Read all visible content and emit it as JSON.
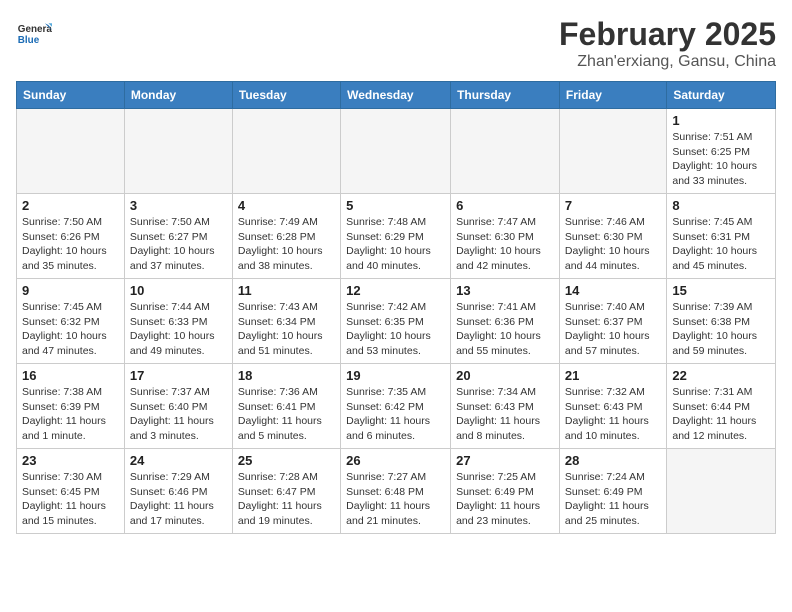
{
  "header": {
    "logo_general": "General",
    "logo_blue": "Blue",
    "month_year": "February 2025",
    "location": "Zhan'erxiang, Gansu, China"
  },
  "days_of_week": [
    "Sunday",
    "Monday",
    "Tuesday",
    "Wednesday",
    "Thursday",
    "Friday",
    "Saturday"
  ],
  "weeks": [
    [
      {
        "day": "",
        "info": ""
      },
      {
        "day": "",
        "info": ""
      },
      {
        "day": "",
        "info": ""
      },
      {
        "day": "",
        "info": ""
      },
      {
        "day": "",
        "info": ""
      },
      {
        "day": "",
        "info": ""
      },
      {
        "day": "1",
        "info": "Sunrise: 7:51 AM\nSunset: 6:25 PM\nDaylight: 10 hours and 33 minutes."
      }
    ],
    [
      {
        "day": "2",
        "info": "Sunrise: 7:50 AM\nSunset: 6:26 PM\nDaylight: 10 hours and 35 minutes."
      },
      {
        "day": "3",
        "info": "Sunrise: 7:50 AM\nSunset: 6:27 PM\nDaylight: 10 hours and 37 minutes."
      },
      {
        "day": "4",
        "info": "Sunrise: 7:49 AM\nSunset: 6:28 PM\nDaylight: 10 hours and 38 minutes."
      },
      {
        "day": "5",
        "info": "Sunrise: 7:48 AM\nSunset: 6:29 PM\nDaylight: 10 hours and 40 minutes."
      },
      {
        "day": "6",
        "info": "Sunrise: 7:47 AM\nSunset: 6:30 PM\nDaylight: 10 hours and 42 minutes."
      },
      {
        "day": "7",
        "info": "Sunrise: 7:46 AM\nSunset: 6:30 PM\nDaylight: 10 hours and 44 minutes."
      },
      {
        "day": "8",
        "info": "Sunrise: 7:45 AM\nSunset: 6:31 PM\nDaylight: 10 hours and 45 minutes."
      }
    ],
    [
      {
        "day": "9",
        "info": "Sunrise: 7:45 AM\nSunset: 6:32 PM\nDaylight: 10 hours and 47 minutes."
      },
      {
        "day": "10",
        "info": "Sunrise: 7:44 AM\nSunset: 6:33 PM\nDaylight: 10 hours and 49 minutes."
      },
      {
        "day": "11",
        "info": "Sunrise: 7:43 AM\nSunset: 6:34 PM\nDaylight: 10 hours and 51 minutes."
      },
      {
        "day": "12",
        "info": "Sunrise: 7:42 AM\nSunset: 6:35 PM\nDaylight: 10 hours and 53 minutes."
      },
      {
        "day": "13",
        "info": "Sunrise: 7:41 AM\nSunset: 6:36 PM\nDaylight: 10 hours and 55 minutes."
      },
      {
        "day": "14",
        "info": "Sunrise: 7:40 AM\nSunset: 6:37 PM\nDaylight: 10 hours and 57 minutes."
      },
      {
        "day": "15",
        "info": "Sunrise: 7:39 AM\nSunset: 6:38 PM\nDaylight: 10 hours and 59 minutes."
      }
    ],
    [
      {
        "day": "16",
        "info": "Sunrise: 7:38 AM\nSunset: 6:39 PM\nDaylight: 11 hours and 1 minute."
      },
      {
        "day": "17",
        "info": "Sunrise: 7:37 AM\nSunset: 6:40 PM\nDaylight: 11 hours and 3 minutes."
      },
      {
        "day": "18",
        "info": "Sunrise: 7:36 AM\nSunset: 6:41 PM\nDaylight: 11 hours and 5 minutes."
      },
      {
        "day": "19",
        "info": "Sunrise: 7:35 AM\nSunset: 6:42 PM\nDaylight: 11 hours and 6 minutes."
      },
      {
        "day": "20",
        "info": "Sunrise: 7:34 AM\nSunset: 6:43 PM\nDaylight: 11 hours and 8 minutes."
      },
      {
        "day": "21",
        "info": "Sunrise: 7:32 AM\nSunset: 6:43 PM\nDaylight: 11 hours and 10 minutes."
      },
      {
        "day": "22",
        "info": "Sunrise: 7:31 AM\nSunset: 6:44 PM\nDaylight: 11 hours and 12 minutes."
      }
    ],
    [
      {
        "day": "23",
        "info": "Sunrise: 7:30 AM\nSunset: 6:45 PM\nDaylight: 11 hours and 15 minutes."
      },
      {
        "day": "24",
        "info": "Sunrise: 7:29 AM\nSunset: 6:46 PM\nDaylight: 11 hours and 17 minutes."
      },
      {
        "day": "25",
        "info": "Sunrise: 7:28 AM\nSunset: 6:47 PM\nDaylight: 11 hours and 19 minutes."
      },
      {
        "day": "26",
        "info": "Sunrise: 7:27 AM\nSunset: 6:48 PM\nDaylight: 11 hours and 21 minutes."
      },
      {
        "day": "27",
        "info": "Sunrise: 7:25 AM\nSunset: 6:49 PM\nDaylight: 11 hours and 23 minutes."
      },
      {
        "day": "28",
        "info": "Sunrise: 7:24 AM\nSunset: 6:49 PM\nDaylight: 11 hours and 25 minutes."
      },
      {
        "day": "",
        "info": ""
      }
    ]
  ]
}
